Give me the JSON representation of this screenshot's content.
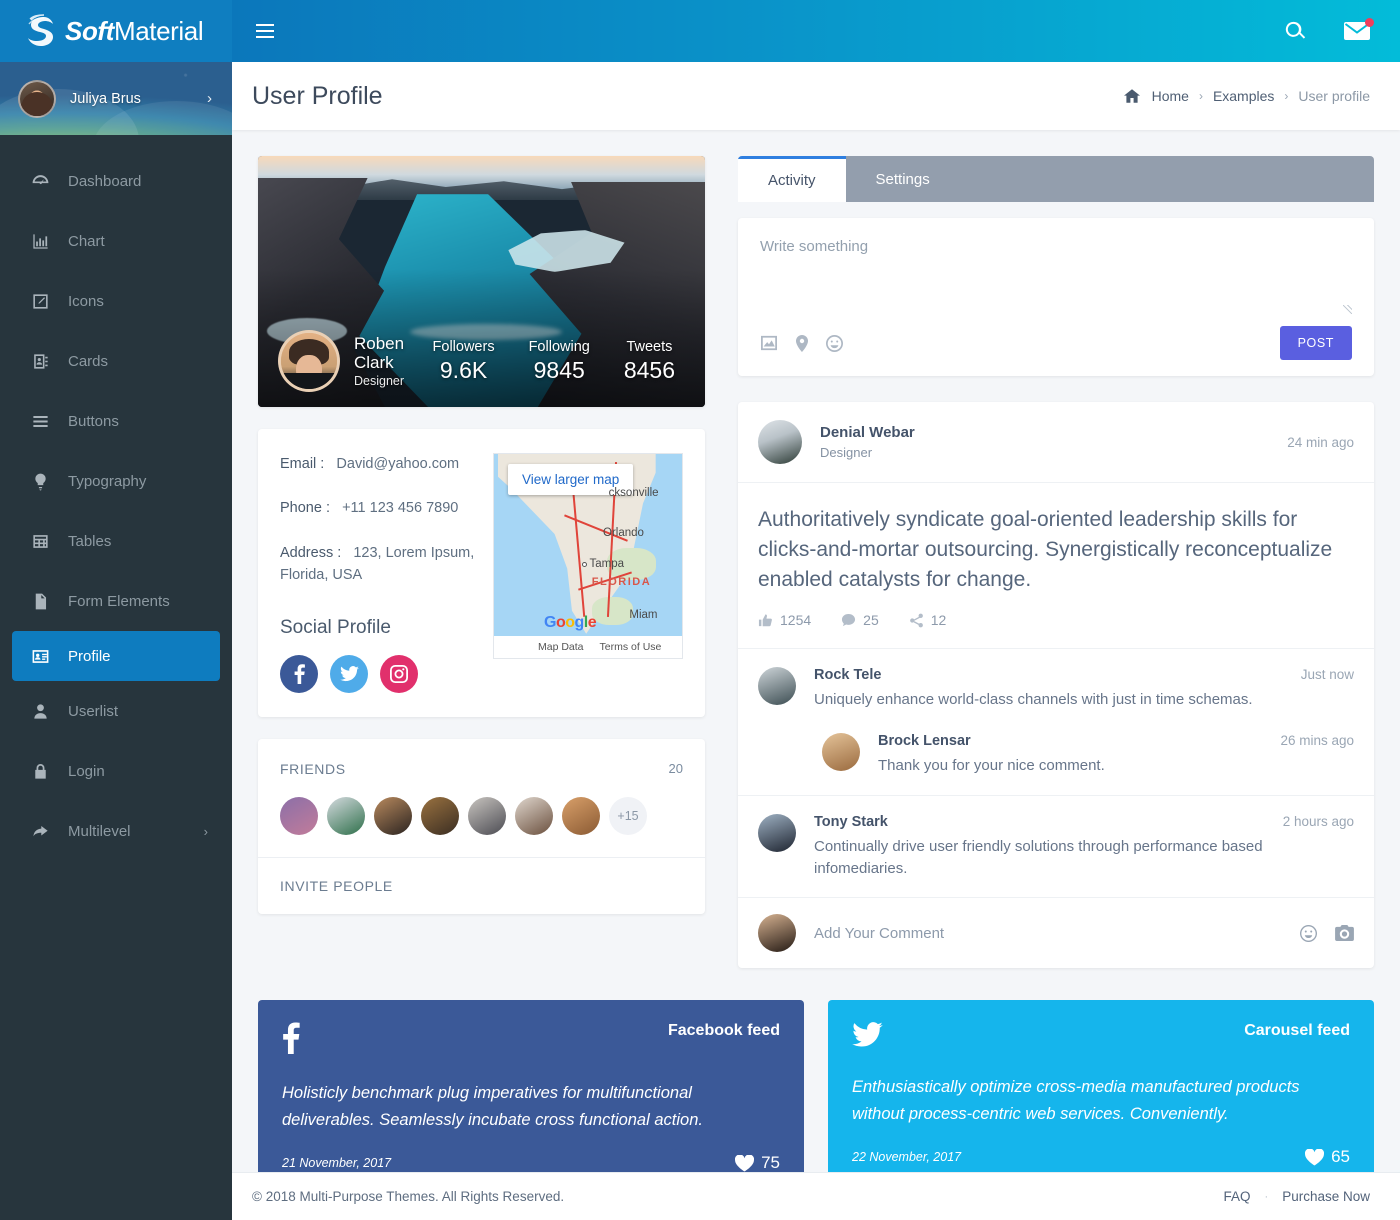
{
  "brand": {
    "bold": "Soft",
    "light": "Material",
    "logo_icon": "s-swirl-logo-icon"
  },
  "sidebar": {
    "user": {
      "name": "Juliya Brus",
      "arrow": "›"
    },
    "items": [
      {
        "label": "Dashboard",
        "icon": "speedometer-icon",
        "active": false
      },
      {
        "label": "Chart",
        "icon": "bar-chart-icon",
        "active": false
      },
      {
        "label": "Icons",
        "icon": "pencil-square-icon",
        "active": false
      },
      {
        "label": "Cards",
        "icon": "address-book-icon",
        "active": false
      },
      {
        "label": "Buttons",
        "icon": "list-lines-icon",
        "active": false
      },
      {
        "label": "Typography",
        "icon": "lightbulb-icon",
        "active": false
      },
      {
        "label": "Tables",
        "icon": "table-grid-icon",
        "active": false
      },
      {
        "label": "Form Elements",
        "icon": "file-document-icon",
        "active": false
      },
      {
        "label": "Profile",
        "icon": "id-card-icon",
        "active": true
      },
      {
        "label": "Userlist",
        "icon": "user-icon",
        "active": false
      },
      {
        "label": "Login",
        "icon": "lock-icon",
        "active": false
      },
      {
        "label": "Multilevel",
        "icon": "share-arrow-icon",
        "active": false,
        "chevron": "›"
      }
    ]
  },
  "topbar": {
    "menu_toggle_icon": "hamburger-icon",
    "search_icon": "search-icon",
    "mail_icon": "envelope-icon",
    "mail_badge": true
  },
  "page": {
    "title": "User Profile",
    "breadcrumb": {
      "home_icon": "home-icon",
      "items": [
        "Home",
        "Examples",
        "User profile"
      ],
      "separator": "›"
    }
  },
  "profile": {
    "name_line1": "Roben",
    "name_line2": "Clark",
    "role": "Designer",
    "stats": [
      {
        "label": "Followers",
        "value": "9.6K"
      },
      {
        "label": "Following",
        "value": "9845"
      },
      {
        "label": "Tweets",
        "value": "8456"
      }
    ]
  },
  "contact": {
    "email_label": "Email :",
    "email_value": "David@yahoo.com",
    "phone_label": "Phone :",
    "phone_value": "+11 123 456 7890",
    "address_label": "Address :",
    "address_value": "123, Lorem Ipsum, Florida, USA",
    "social_title": "Social Profile",
    "socials": [
      {
        "name": "facebook-icon",
        "color": "#3b5998"
      },
      {
        "name": "twitter-icon",
        "color": "#4fabe9"
      },
      {
        "name": "instagram-icon",
        "color": "#e1306c"
      }
    ],
    "map": {
      "view_larger": "View larger map",
      "cities": [
        "cksonville",
        "Orlando",
        "Tampa",
        "Miam"
      ],
      "state": "FLORIDA",
      "google": "Google",
      "map_data": "Map Data",
      "terms": "Terms of Use"
    }
  },
  "friends": {
    "title": "FRIENDS",
    "count": "20",
    "more_label": "+15",
    "invite_label": "INVITE PEOPLE",
    "avatars": [
      {
        "c1": "#8b6fa8",
        "c2": "#c27c9a"
      },
      {
        "c1": "#d6dbe0",
        "c2": "#2e6f4a"
      },
      {
        "c1": "#b98a5e",
        "c2": "#2a2320"
      },
      {
        "c1": "#9a7240",
        "c2": "#3a2d22"
      },
      {
        "c1": "#c9c5c0",
        "c2": "#4b4b52"
      },
      {
        "c1": "#e0d7ce",
        "c2": "#6a4f3d"
      },
      {
        "c1": "#d9a06a",
        "c2": "#8a5a33"
      }
    ]
  },
  "tabs": [
    {
      "label": "Activity",
      "active": true
    },
    {
      "label": "Settings",
      "active": false
    }
  ],
  "composer": {
    "placeholder": "Write something",
    "icons": [
      "image-icon",
      "location-pin-icon",
      "smiley-icon"
    ],
    "post_button": "POST"
  },
  "post": {
    "author": "Denial Webar",
    "role": "Designer",
    "time": "24 min ago",
    "text": "Authoritatively syndicate goal-oriented leadership skills for clicks-and-mortar outsourcing. Synergistically reconceptualize enabled catalysts for change.",
    "actions": [
      {
        "icon": "thumbs-up-icon",
        "value": "1254"
      },
      {
        "icon": "comment-bubble-icon",
        "value": "25"
      },
      {
        "icon": "share-icon",
        "value": "12"
      }
    ],
    "comments": [
      {
        "name": "Rock Tele",
        "time": "Just now",
        "text": "Uniquely enhance world-class channels with just in time schemas.",
        "nested": false
      },
      {
        "name": "Brock Lensar",
        "time": "26 mins ago",
        "text": "Thank you for your nice comment.",
        "nested": true
      },
      {
        "name": "Tony Stark",
        "time": "2 hours ago",
        "text": "Continually drive user friendly solutions through performance based infomediaries.",
        "nested": false
      }
    ],
    "add_comment_placeholder": "Add Your Comment",
    "add_comment_icons": [
      "smiley-icon",
      "camera-icon"
    ]
  },
  "feeds": [
    {
      "platform_icon": "facebook-f-icon",
      "title": "Facebook feed",
      "text": "Holisticly benchmark plug imperatives for multifunctional deliverables. Seamlessly incubate cross functional action.",
      "date": "21 November, 2017",
      "likes": "75",
      "color": "#3b5998"
    },
    {
      "platform_icon": "twitter-bird-icon",
      "title": "Carousel feed",
      "text": "Enthusiastically optimize cross-media manufactured products without process-centric web services. Conveniently.",
      "date": "22 November, 2017",
      "likes": "65",
      "color": "#15b5ec"
    }
  ],
  "footer": {
    "copyright": "© 2018 Multi-Purpose Themes. All Rights Reserved.",
    "links": [
      "FAQ",
      "Purchase Now"
    ],
    "separator": "·"
  },
  "colors": {
    "header_start": "#0b77bb",
    "header_end": "#03bcd9",
    "sidebar_bg": "#27353d",
    "active_blue": "#0e7cbf",
    "post_button": "#5a5fe0",
    "tabs_bg": "#939ead",
    "facebook": "#3b5998",
    "twitter": "#15b5ec",
    "instagram": "#e1306c",
    "badge_red": "#ef3e5c"
  }
}
